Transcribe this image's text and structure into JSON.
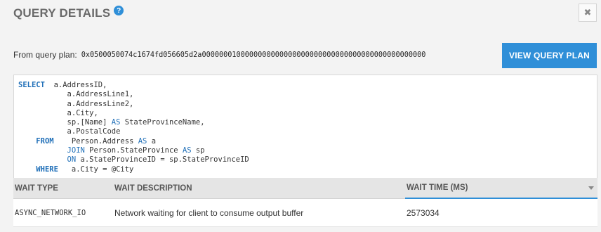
{
  "dialog": {
    "title": "QUERY DETAILS",
    "help_icon": "?",
    "close_icon": "✖"
  },
  "plan": {
    "label": "From query plan:",
    "hash": "0x0500050074c1674fd056605d2a0000000100000000000000000000000000000000000000000000",
    "button_label": "VIEW QUERY PLAN"
  },
  "sql": {
    "lines": [
      "a.AddressID,",
      "a.AddressLine1,",
      "a.AddressLine2,",
      "a.City,",
      "sp.[Name] ",
      "a.PostalCode",
      "Person.Address ",
      "Person.StateProvince ",
      "a.StateProvinceID = sp.StateProvinceID",
      "a.City = @City"
    ],
    "keywords": {
      "select": "SELECT",
      "from": "FROM",
      "where": "WHERE",
      "as": "AS",
      "join": "JOIN",
      "on": "ON"
    },
    "aliases": {
      "state_province_name": " StateProvinceName,",
      "address_alias": " a",
      "state_province_alias": " sp"
    }
  },
  "table": {
    "headers": [
      "WAIT TYPE",
      "WAIT DESCRIPTION",
      "WAIT TIME (MS)"
    ],
    "rows": [
      {
        "wait_type": "ASYNC_NETWORK_IO",
        "wait_description": "Network waiting for client to consume output buffer",
        "wait_time": "2573034"
      }
    ]
  },
  "colors": {
    "accent": "#2f8fd8",
    "keyword": "#1f6fb8",
    "background": "#f3f3f3"
  }
}
